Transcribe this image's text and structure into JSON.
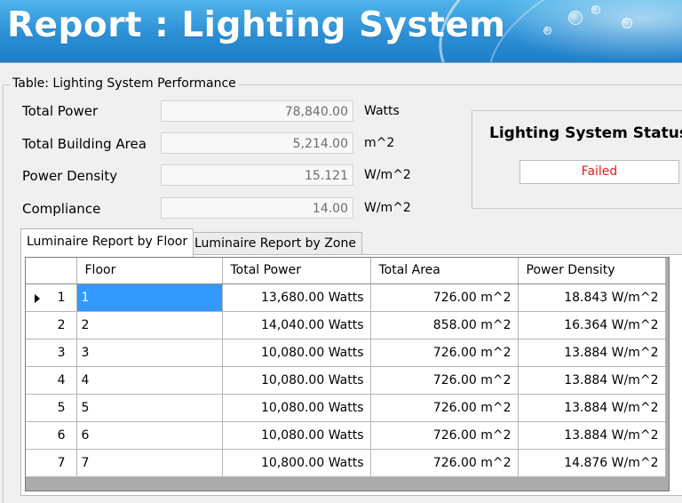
{
  "header": {
    "title": "Report : Lighting System"
  },
  "group": {
    "legend": "Table: Lighting System Performance",
    "fields": [
      {
        "label": "Total Power",
        "value": "78,840.00",
        "unit": "Watts"
      },
      {
        "label": "Total Building Area",
        "value": "5,214.00",
        "unit": "m^2"
      },
      {
        "label": "Power Density",
        "value": "15.121",
        "unit": "W/m^2"
      },
      {
        "label": "Compliance",
        "value": "14.00",
        "unit": "W/m^2"
      }
    ]
  },
  "status": {
    "title": "Lighting System Status",
    "value": "Failed",
    "value_color": "#e02020"
  },
  "tabs": [
    {
      "label": "Luminaire Report by Floor",
      "active": true
    },
    {
      "label": "Luminaire Report by Zone",
      "active": false
    }
  ],
  "grid": {
    "columns": [
      "Floor",
      "Total Power",
      "Total Area",
      "Power Density"
    ],
    "rows": [
      {
        "row_header": "1",
        "floor": "1",
        "power": "13,680.00 Watts",
        "area": "726.00 m^2",
        "density": "18.843 W/m^2",
        "current": true
      },
      {
        "row_header": "2",
        "floor": "2",
        "power": "14,040.00 Watts",
        "area": "858.00 m^2",
        "density": "16.364 W/m^2"
      },
      {
        "row_header": "3",
        "floor": "3",
        "power": "10,080.00 Watts",
        "area": "726.00 m^2",
        "density": "13.884 W/m^2"
      },
      {
        "row_header": "4",
        "floor": "4",
        "power": "10,080.00 Watts",
        "area": "726.00 m^2",
        "density": "13.884 W/m^2"
      },
      {
        "row_header": "5",
        "floor": "5",
        "power": "10,080.00 Watts",
        "area": "726.00 m^2",
        "density": "13.884 W/m^2"
      },
      {
        "row_header": "6",
        "floor": "6",
        "power": "10,080.00 Watts",
        "area": "726.00 m^2",
        "density": "13.884 W/m^2"
      },
      {
        "row_header": "7",
        "floor": "7",
        "power": "10,800.00 Watts",
        "area": "726.00 m^2",
        "density": "14.876 W/m^2"
      }
    ]
  },
  "colors": {
    "banner": "#2b8fd6",
    "selection": "#3399ff",
    "failed": "#e02020"
  }
}
